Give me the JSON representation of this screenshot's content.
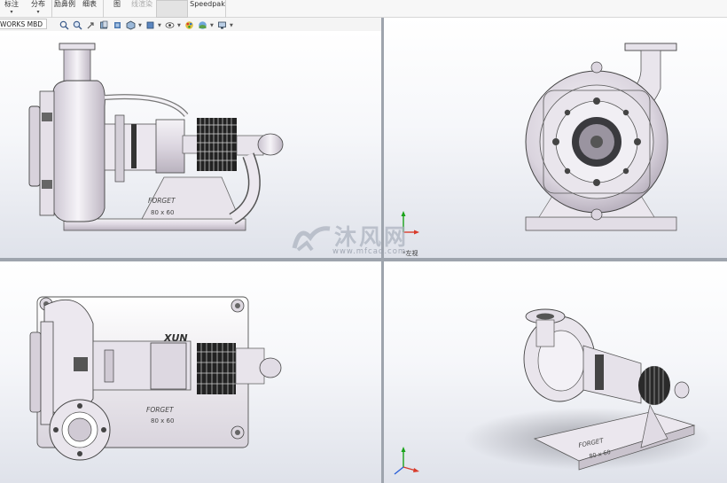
{
  "ribbon": {
    "items": [
      {
        "label": "标注",
        "dd": "▾"
      },
      {
        "label": "分布",
        "dd": "▾"
      },
      {
        "label": "励鼻例",
        "dd": ""
      },
      {
        "label": "细表",
        "dd": ""
      },
      {
        "label": "图",
        "dd": ""
      },
      {
        "label": "线渲染",
        "dd": ""
      }
    ],
    "addin": "Speedpak"
  },
  "tabs": {
    "mbd_tab": "WORKS MBD"
  },
  "hud_icons": [
    "zoom-to-fit-icon",
    "zoom-area-icon",
    "previous-view-icon",
    "section-view-icon",
    "dynamic-annotation-icon",
    "view-orientation-icon",
    "display-style-icon",
    "hide-show-items-icon",
    "edit-appearance-icon",
    "apply-scene-icon",
    "view-settings-icon"
  ],
  "views": {
    "top_right_label": "*左视"
  },
  "model": {
    "brand": "FORGET",
    "size": "80 x 60",
    "top_plate_mark": "XUN"
  },
  "watermark": {
    "text": "沐风网",
    "url": "www.mfcad.com"
  },
  "colors": {
    "triad_y": "#1aa31a",
    "triad_x": "#d83a2a",
    "triad_z": "#2a5fd8",
    "divider": "#9ea4ad"
  }
}
